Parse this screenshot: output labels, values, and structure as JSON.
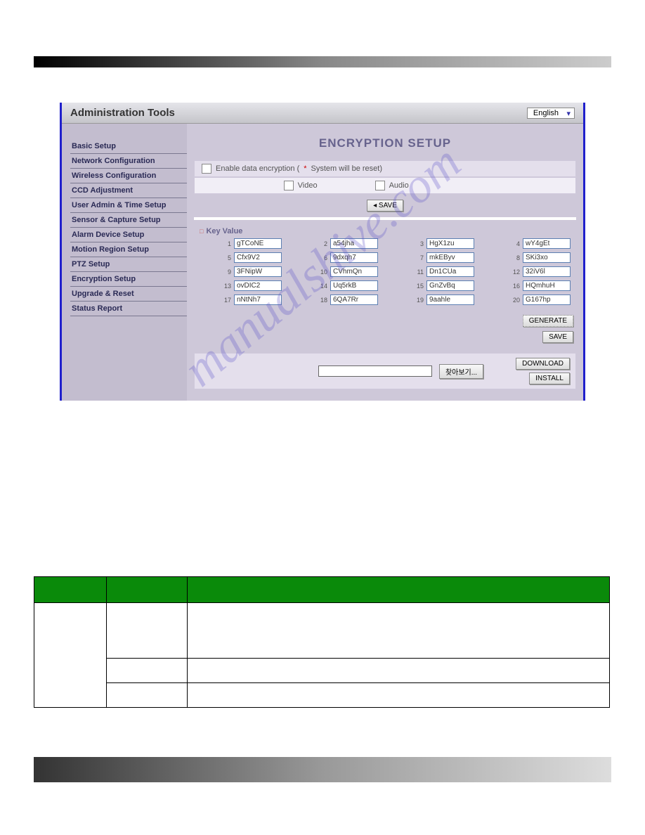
{
  "header_title": "Administration Tools",
  "lang_selected": "English",
  "sidebar": [
    "Basic Setup",
    "Network Configuration",
    "Wireless Configuration",
    "CCD Adjustment",
    "User Admin & Time Setup",
    "Sensor & Capture Setup",
    "Alarm Device Setup",
    "Motion Region Setup",
    "PTZ Setup",
    "Encryption Setup",
    "Upgrade & Reset",
    "Status Report"
  ],
  "content_title": "ENCRYPTION SETUP",
  "enable_label": "Enable data encryption (",
  "enable_reset": " System will be reset)",
  "video_label": "Video",
  "audio_label": "Audio",
  "save_btn": "◂ SAVE",
  "kv_title": "Key Value",
  "key_values": [
    "gTCoNE",
    "a54jha",
    "HgX1zu",
    "wY4gEt",
    "Cfx9V2",
    "9dxqh7",
    "mkEByv",
    "SKi3xo",
    "3FNipW",
    "CVhmQn",
    "Dn1CUa",
    "32iV6l",
    "ovDIC2",
    "Uq5rkB",
    "GnZvBq",
    "HQmhuH",
    "nNtNh7",
    "6QA7Rr",
    "9aahle",
    "G167hp"
  ],
  "generate_btn": "GENERATE",
  "save_btn2": "SAVE",
  "download_btn": "DOWNLOAD",
  "install_btn": "INSTALL",
  "browse_btn": "찾아보기...",
  "watermark": "manualshive.com"
}
